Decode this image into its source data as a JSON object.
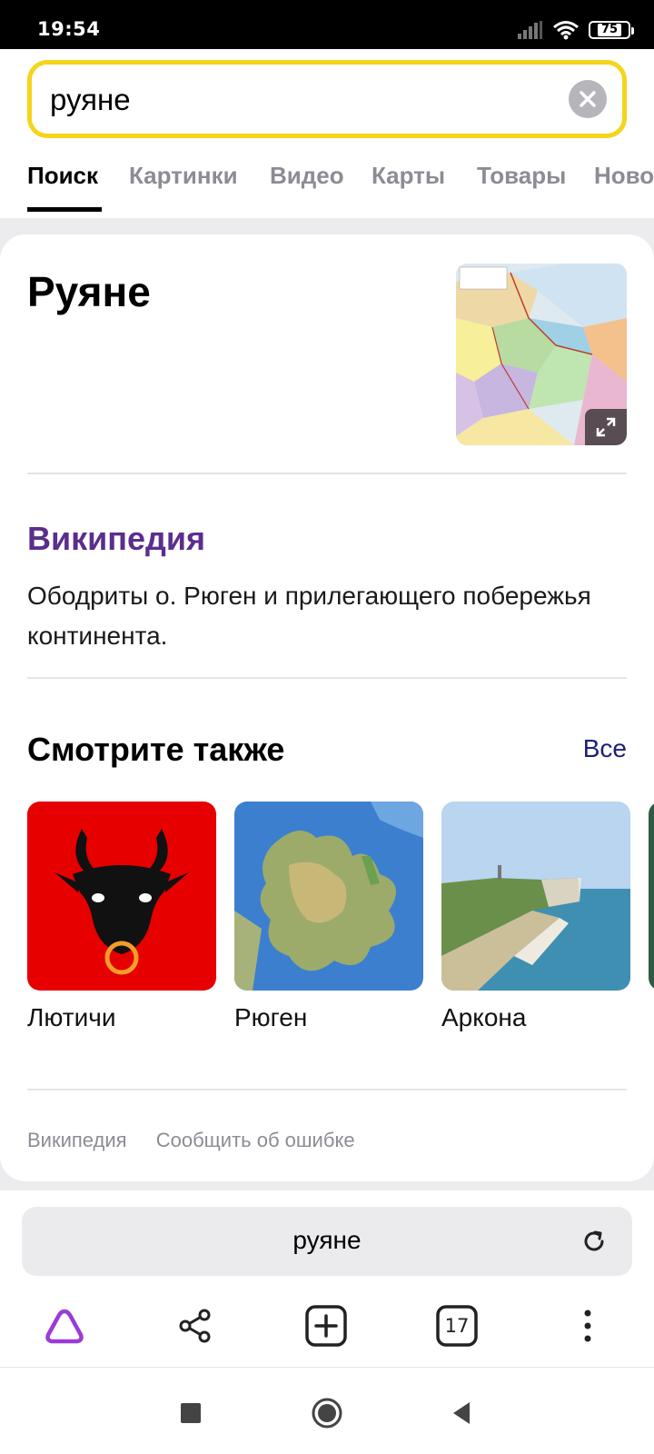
{
  "status_bar": {
    "time": "19:54",
    "battery": "75"
  },
  "search": {
    "query": "руяне"
  },
  "tabs": [
    {
      "label": "Поиск"
    },
    {
      "label": "Картинки"
    },
    {
      "label": "Видео"
    },
    {
      "label": "Карты"
    },
    {
      "label": "Товары"
    },
    {
      "label": "Ново"
    }
  ],
  "entity": {
    "title": "Руяне"
  },
  "wiki": {
    "source": "Википедия",
    "text": "Ободриты о. Рюген и прилегающего побережья континента."
  },
  "see_also": {
    "title": "Смотрите также",
    "all_label": "Все",
    "items": [
      {
        "label": "Лютичи"
      },
      {
        "label": "Рюген"
      },
      {
        "label": "Аркона"
      }
    ]
  },
  "footer": {
    "link1": "Википедия",
    "link2": "Сообщить об ошибке"
  },
  "address_bar": {
    "text": "руяне"
  },
  "toolbar": {
    "tabs_count": "17"
  },
  "colors": {
    "search_border": "#f5d41b",
    "wiki_link": "#5b2e8c",
    "alice": "#9b3bd6"
  }
}
